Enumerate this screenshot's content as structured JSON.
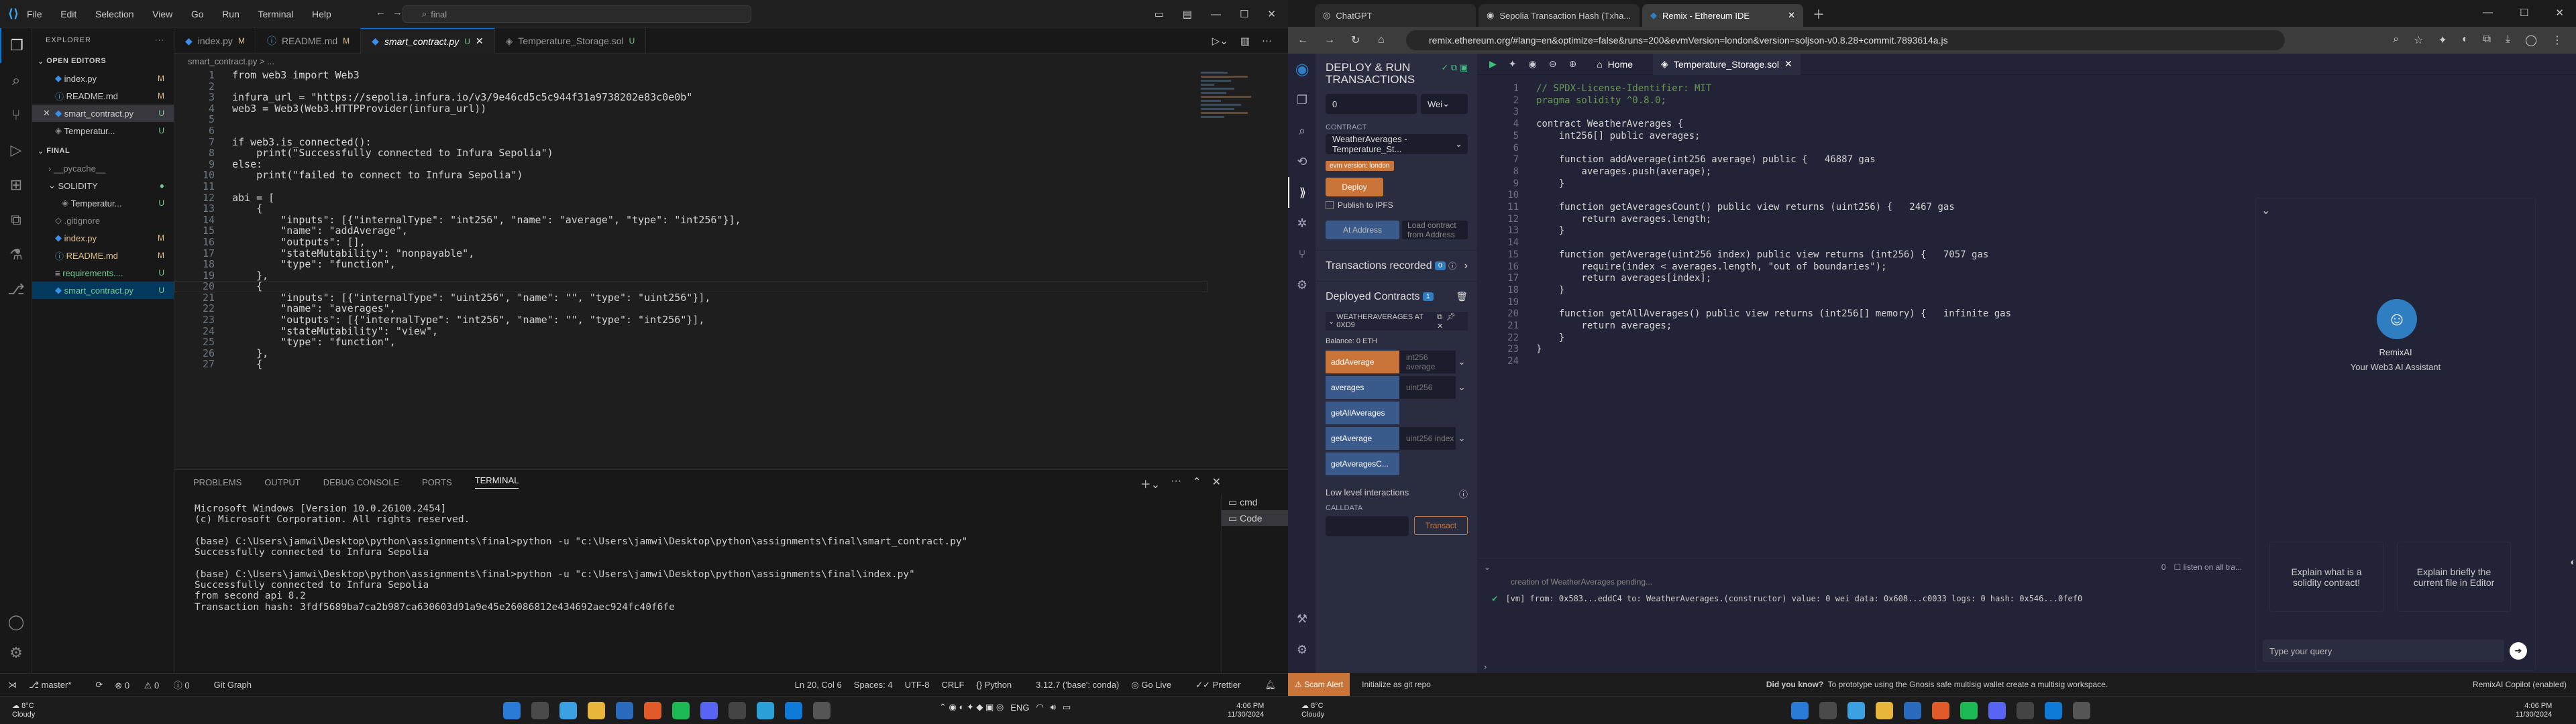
{
  "vscode": {
    "menu": [
      "File",
      "Edit",
      "Selection",
      "View",
      "Go",
      "Run",
      "Terminal",
      "Help"
    ],
    "search": "final",
    "explorer_title": "EXPLORER",
    "open_editors_title": "OPEN EDITORS",
    "open_editors": [
      {
        "name": "index.py",
        "mark": "M"
      },
      {
        "name": "README.md",
        "mark": "M"
      },
      {
        "name": "smart_contract.py",
        "mark": "U"
      },
      {
        "name": "Temperatur...",
        "mark": "U"
      }
    ],
    "final_title": "FINAL",
    "tree": [
      {
        "name": "__pycache__",
        "mark": ""
      },
      {
        "name": "SOLIDITY",
        "mark": ""
      },
      {
        "name": "Temperatur...",
        "mark": "U"
      },
      {
        "name": ".gitignore",
        "mark": ""
      },
      {
        "name": "index.py",
        "mark": "M"
      },
      {
        "name": "README.md",
        "mark": "M"
      },
      {
        "name": "requirements....",
        "mark": "U"
      },
      {
        "name": "smart_contract.py",
        "mark": "U"
      }
    ],
    "tabs": [
      {
        "name": "index.py",
        "mark": "M"
      },
      {
        "name": "README.md",
        "mark": "M"
      },
      {
        "name": "smart_contract.py",
        "mark": "U"
      },
      {
        "name": "Temperature_Storage.sol",
        "mark": "U"
      }
    ],
    "breadcrumb": "smart_contract.py > ...",
    "line_numbers": [
      "1",
      "2",
      "3",
      "4",
      "5",
      "6",
      "7",
      "8",
      "9",
      "10",
      "11",
      "12",
      "13",
      "14",
      "15",
      "16",
      "17",
      "18",
      "19",
      "20",
      "21",
      "22",
      "23",
      "24",
      "25",
      "26",
      "27"
    ],
    "code_lines": [
      "from web3 import Web3",
      "",
      "infura_url = \"https://sepolia.infura.io/v3/9e46cd5c5c944f31a9738202e83c0e0b\"",
      "web3 = Web3(Web3.HTTPProvider(infura_url))",
      "",
      "",
      "if web3.is_connected():",
      "    print(\"Successfully connected to Infura Sepolia\")",
      "else:",
      "    print(\"failed to connect to Infura Sepolia\")",
      "",
      "abi = [",
      "    {",
      "        \"inputs\": [{\"internalType\": \"int256\", \"name\": \"average\", \"type\": \"int256\"}],",
      "        \"name\": \"addAverage\",",
      "        \"outputs\": [],",
      "        \"stateMutability\": \"nonpayable\",",
      "        \"type\": \"function\",",
      "    },",
      "    {",
      "        \"inputs\": [{\"internalType\": \"uint256\", \"name\": \"\", \"type\": \"uint256\"}],",
      "        \"name\": \"averages\",",
      "        \"outputs\": [{\"internalType\": \"int256\", \"name\": \"\", \"type\": \"int256\"}],",
      "        \"stateMutability\": \"view\",",
      "        \"type\": \"function\",",
      "    },",
      "    {"
    ],
    "panel_tabs": [
      "PROBLEMS",
      "OUTPUT",
      "DEBUG CONSOLE",
      "PORTS",
      "TERMINAL"
    ],
    "terminal_lines": [
      "Microsoft Windows [Version 10.0.26100.2454]",
      "(c) Microsoft Corporation. All rights reserved.",
      "",
      "(base) C:\\Users\\jamwi\\Desktop\\python\\assignments\\final>python -u \"c:\\Users\\jamwi\\Desktop\\python\\assignments\\final\\smart_contract.py\"",
      "Successfully connected to Infura Sepolia",
      "",
      "(base) C:\\Users\\jamwi\\Desktop\\python\\assignments\\final>python -u \"c:\\Users\\jamwi\\Desktop\\python\\assignments\\final\\index.py\"",
      "Successfully connected to Infura Sepolia",
      "from second api 8.2",
      "Transaction hash: 3fdf5689ba7ca2b987ca630603d91a9e45e26086812e434692aec924fc40f6fe"
    ],
    "term_list": [
      "cmd",
      "Code"
    ],
    "status": {
      "branch": "master*",
      "errors": "0",
      "warnings": "0",
      "info": "0",
      "git_graph": "Git Graph",
      "position": "Ln 20, Col 6",
      "spaces": "Spaces: 4",
      "encoding": "UTF-8",
      "eol": "CRLF",
      "lang": "Python",
      "interpreter": "3.12.7 ('base': conda)",
      "golive": "Go Live",
      "prettier": "Prettier"
    }
  },
  "browser": {
    "tabs": [
      "ChatGPT",
      "Sepolia Transaction Hash (Txha...",
      "Remix - Ethereum IDE"
    ],
    "url": "remix.ethereum.org/#lang=en&optimize=false&runs=200&evmVersion=london&version=soljson-v0.8.28+commit.7893614a.js"
  },
  "remix": {
    "panel_title": "DEPLOY & RUN TRANSACTIONS",
    "value": "0",
    "value_unit": "Wei",
    "contract_label": "CONTRACT",
    "contract": "WeatherAverages - Temperature_St...",
    "evm_badge": "evm version: london",
    "deploy": "Deploy",
    "publish": "Publish to IPFS",
    "at_address": "At Address",
    "load_contract": "Load contract from Address",
    "recorded": "Transactions recorded",
    "recorded_count": "0",
    "deployed_title": "Deployed Contracts",
    "deployed_count": "1",
    "instance": "WEATHERAVERAGES AT 0XD9",
    "balance": "Balance: 0 ETH",
    "functions": [
      {
        "name": "addAverage",
        "placeholder": "int256 average",
        "color": "#c97539"
      },
      {
        "name": "averages",
        "placeholder": "uint256",
        "color": "#3a5a8c"
      },
      {
        "name": "getAllAverages",
        "placeholder": "",
        "color": "#3a5a8c"
      },
      {
        "name": "getAverage",
        "placeholder": "uint256 index",
        "color": "#3a5a8c"
      },
      {
        "name": "getAveragesC...",
        "placeholder": "",
        "color": "#3a5a8c"
      }
    ],
    "low_level": "Low level interactions",
    "calldata": "CALLDATA",
    "transact": "Transact",
    "home_tab": "Home",
    "file_tab": "Temperature_Storage.sol",
    "line_numbers": [
      "1",
      "2",
      "3",
      "4",
      "5",
      "6",
      "7",
      "8",
      "9",
      "10",
      "11",
      "12",
      "13",
      "14",
      "15",
      "16",
      "17",
      "18",
      "19",
      "20",
      "21",
      "22",
      "23",
      "24"
    ],
    "code_lines": [
      "// SPDX-License-Identifier: MIT",
      "pragma solidity ^0.8.0;",
      "",
      "contract WeatherAverages {",
      "    int256[] public averages;",
      "",
      "    function addAverage(int256 average) public {   46887 gas",
      "        averages.push(average);",
      "    }",
      "",
      "    function getAveragesCount() public view returns (uint256) {   2467 gas",
      "        return averages.length;",
      "    }",
      "",
      "    function getAverage(uint256 index) public view returns (int256) {   7057 gas",
      "        require(index < averages.length, \"out of boundaries\");",
      "        return averages[index];",
      "    }",
      "",
      "    function getAllAverages() public view returns (int256[] memory) {   infinite gas",
      "        return averages;",
      "    }",
      "}",
      ""
    ],
    "term_count": "0",
    "term_listen": "listen on all tra...",
    "term_creation": "creation of WeatherAverages pending...",
    "term_log": "[vm]  from: 0x583...eddC4 to: WeatherAverages.(constructor) value: 0 wei data: 0x608...c0033 logs: 0 hash: 0x546...0fef0",
    "ai_title": "RemixAI",
    "ai_sub": "Your Web3 AI Assistant",
    "ai_btn1": "Explain what is a solidity contract!",
    "ai_btn2": "Explain briefly the current file in Editor",
    "ai_placeholder": "Type your query",
    "status_scam": "Scam Alert",
    "status_git": "Initialize as git repo",
    "status_tip_bold": "Did you know?",
    "status_tip": "To prototype using the Gnosis safe multisig wallet create a multisig workspace.",
    "status_copilot": "RemixAI Copilot (enabled)"
  },
  "taskbar": {
    "temp": "8°C",
    "weather": "Cloudy",
    "lang": "ENG",
    "time": "4:06 PM",
    "date": "11/30/2024"
  }
}
